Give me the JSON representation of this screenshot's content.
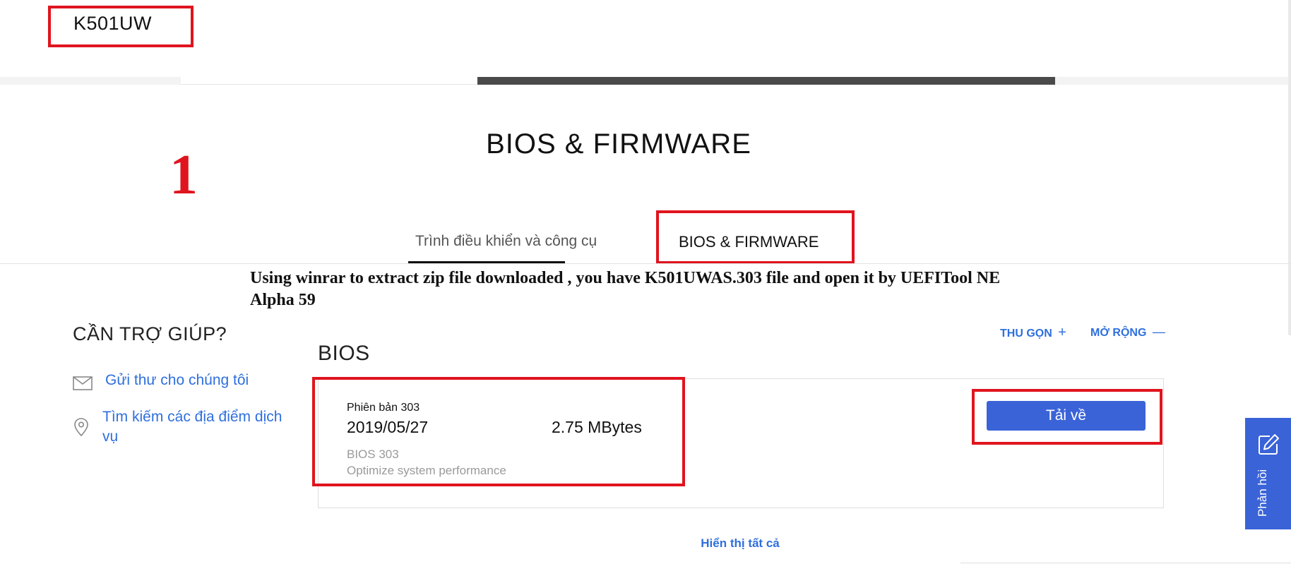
{
  "header": {
    "model": "K501UW"
  },
  "section": {
    "title": "BIOS & FIRMWARE"
  },
  "annotations": {
    "step_number": "1",
    "caption": "Using winrar to extract zip file downloaded , you have K501UWAS.303 file and open it by UEFITool NE Alpha 59"
  },
  "tabs": [
    {
      "label": "Trình điều khiển và công cụ",
      "active": true
    },
    {
      "label": "BIOS & FIRMWARE",
      "active": false
    }
  ],
  "help": {
    "title": "CẦN TRỢ GIÚP?",
    "mail_link": "Gửi thư cho chúng tôi",
    "service_link": "Tìm kiếm các địa điểm dịch vụ",
    "icons": [
      "mail-icon",
      "location-pin-icon"
    ]
  },
  "controls": {
    "collapse": "THU GỌN",
    "collapse_symbol": "+",
    "expand": "MỞ RỘNG",
    "expand_symbol": "—"
  },
  "bios": {
    "heading": "BIOS",
    "version_label": "Phiên bản 303",
    "release_date": "2019/05/27",
    "file_size": "2.75 MBytes",
    "name": "BIOS 303",
    "description": "Optimize system performance",
    "download_label": "Tải về"
  },
  "footer": {
    "show_all": "Hiển thị tất cả"
  },
  "feedback": {
    "label": "Phản hồi",
    "icon": "edit-icon"
  },
  "colors": {
    "highlight_red": "#e0141e",
    "link_blue": "#2f6fdd",
    "button_blue": "#3a63d8",
    "progress_dark": "#4a4a4a"
  }
}
